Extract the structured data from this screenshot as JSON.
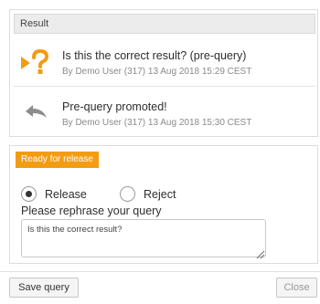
{
  "result_panel": {
    "header": "Result",
    "entries": [
      {
        "icon": "question-arrow-icon",
        "title": "Is this the correct result? (pre-query)",
        "meta": "By Demo User (317) 13 Aug 2018 15:29 CEST"
      },
      {
        "icon": "reply-arrow-icon",
        "title": "Pre-query promoted!",
        "meta": "By Demo User (317) 13 Aug 2018 15:30 CEST"
      }
    ]
  },
  "release_panel": {
    "status": "Ready for release",
    "status_color": "#f39c12",
    "options": [
      {
        "label": "Release",
        "selected": true
      },
      {
        "label": "Reject",
        "selected": false
      }
    ],
    "rephrase_label": "Please rephrase your query",
    "rephrase_value": "Is this the correct result?"
  },
  "footer": {
    "save_label": "Save query",
    "close_label": "Close"
  },
  "colors": {
    "accent": "#f39c12",
    "icon_gray": "#8c8c8c"
  }
}
